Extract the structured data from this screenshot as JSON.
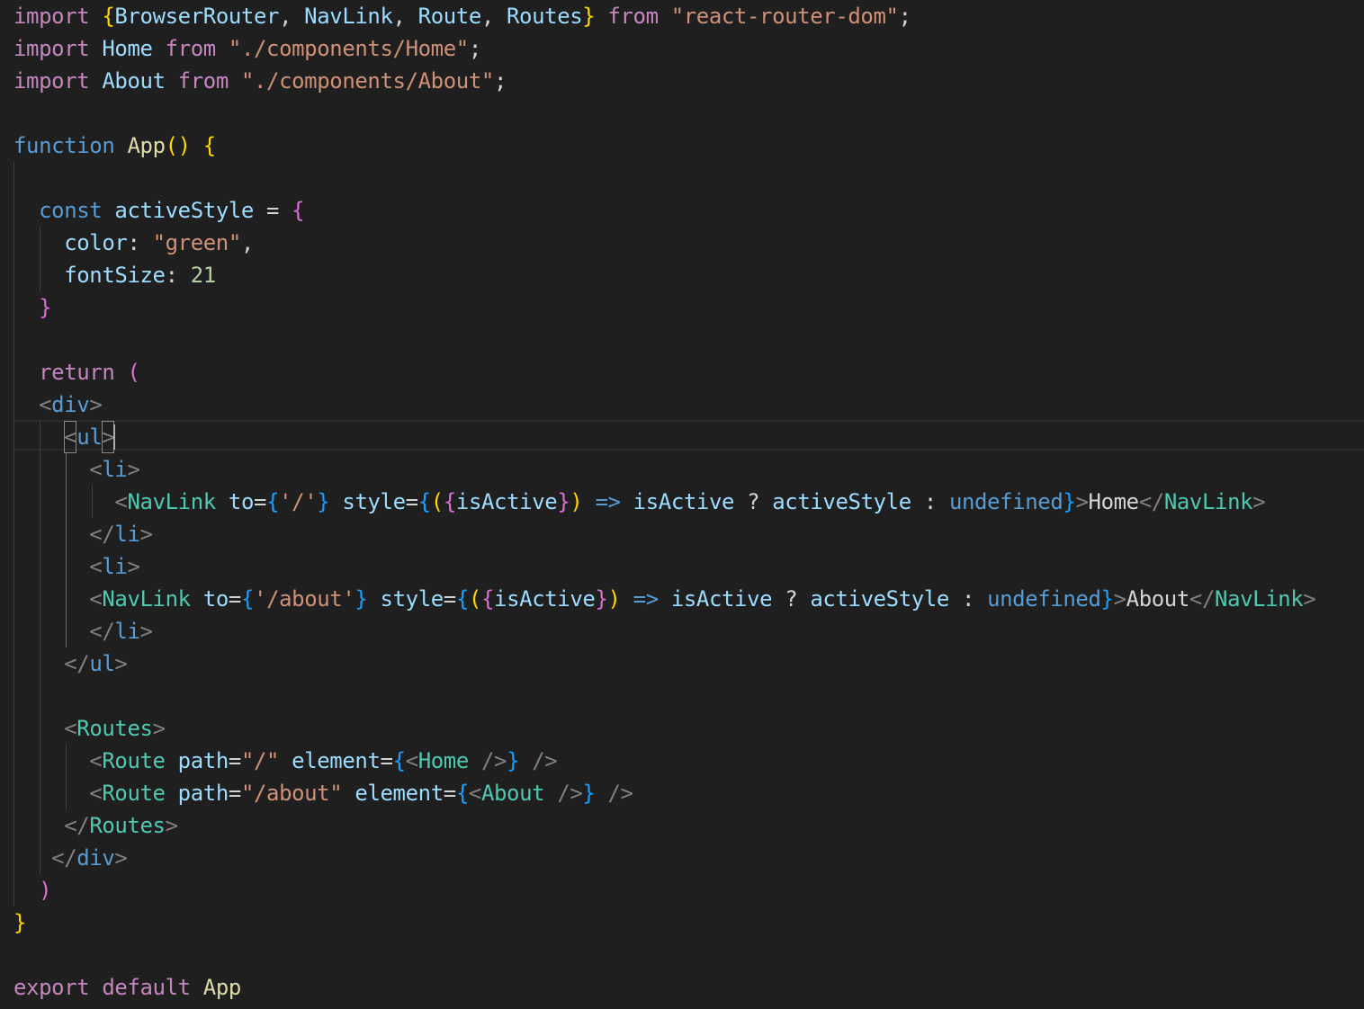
{
  "theme": {
    "background": "#1f1f1f",
    "keyword": "#c586c0",
    "storage": "#569cd6",
    "string": "#ce9178",
    "function": "#dcdcaa",
    "variable": "#9cdcfe",
    "type": "#4ec9b0",
    "number": "#b5cea8",
    "text": "#d4d4d4",
    "tag_bracket": "#808080",
    "bracket_gold": "#ffd700",
    "bracket_purple": "#da70d6",
    "bracket_blue": "#179fff"
  },
  "code": {
    "lines": [
      [
        [
          "import",
          "kw"
        ],
        [
          " ",
          "t"
        ],
        [
          "{",
          "b1"
        ],
        [
          "BrowserRouter",
          "v"
        ],
        [
          ", ",
          "t"
        ],
        [
          "NavLink",
          "v"
        ],
        [
          ", ",
          "t"
        ],
        [
          "Route",
          "v"
        ],
        [
          ", ",
          "t"
        ],
        [
          "Routes",
          "v"
        ],
        [
          "}",
          "b1"
        ],
        [
          " ",
          "t"
        ],
        [
          "from",
          "kw"
        ],
        [
          " ",
          "t"
        ],
        [
          "\"react-router-dom\"",
          "s"
        ],
        [
          ";",
          "t"
        ]
      ],
      [
        [
          "import",
          "kw"
        ],
        [
          " ",
          "t"
        ],
        [
          "Home",
          "v"
        ],
        [
          " ",
          "t"
        ],
        [
          "from",
          "kw"
        ],
        [
          " ",
          "t"
        ],
        [
          "\"./components/Home\"",
          "s"
        ],
        [
          ";",
          "t"
        ]
      ],
      [
        [
          "import",
          "kw"
        ],
        [
          " ",
          "t"
        ],
        [
          "About",
          "v"
        ],
        [
          " ",
          "t"
        ],
        [
          "from",
          "kw"
        ],
        [
          " ",
          "t"
        ],
        [
          "\"./components/About\"",
          "s"
        ],
        [
          ";",
          "t"
        ]
      ],
      [],
      [
        [
          "function",
          "st"
        ],
        [
          " ",
          "t"
        ],
        [
          "App",
          "f"
        ],
        [
          "()",
          "b1"
        ],
        [
          " ",
          "t"
        ],
        [
          "{",
          "b1"
        ]
      ],
      [],
      [
        [
          "  ",
          "t"
        ],
        [
          "const",
          "st"
        ],
        [
          " ",
          "t"
        ],
        [
          "activeStyle",
          "v"
        ],
        [
          " = ",
          "t"
        ],
        [
          "{",
          "b2"
        ]
      ],
      [
        [
          "    ",
          "t"
        ],
        [
          "color",
          "v"
        ],
        [
          ": ",
          "t"
        ],
        [
          "\"green\"",
          "s"
        ],
        [
          ",",
          "t"
        ]
      ],
      [
        [
          "    ",
          "t"
        ],
        [
          "fontSize",
          "v"
        ],
        [
          ": ",
          "t"
        ],
        [
          "21",
          "n"
        ]
      ],
      [
        [
          "  ",
          "t"
        ],
        [
          "}",
          "b2"
        ]
      ],
      [],
      [
        [
          "  ",
          "t"
        ],
        [
          "return",
          "kw"
        ],
        [
          " ",
          "t"
        ],
        [
          "(",
          "b2"
        ]
      ],
      [
        [
          "  ",
          "t"
        ],
        [
          "<",
          "g"
        ],
        [
          "div",
          "st"
        ],
        [
          ">",
          "g"
        ]
      ],
      [
        [
          "    ",
          "t"
        ],
        [
          "<",
          "gbox"
        ],
        [
          "ul",
          "st"
        ],
        [
          ">",
          "gbox"
        ]
      ],
      [
        [
          "      ",
          "t"
        ],
        [
          "<",
          "g"
        ],
        [
          "li",
          "st"
        ],
        [
          ">",
          "g"
        ]
      ],
      [
        [
          "        ",
          "t"
        ],
        [
          "<",
          "g"
        ],
        [
          "NavLink",
          "ty"
        ],
        [
          " ",
          "t"
        ],
        [
          "to",
          "v"
        ],
        [
          "=",
          "t"
        ],
        [
          "{",
          "b3"
        ],
        [
          "'/'",
          "s"
        ],
        [
          "}",
          "b3"
        ],
        [
          " ",
          "t"
        ],
        [
          "style",
          "v"
        ],
        [
          "=",
          "t"
        ],
        [
          "{",
          "b3"
        ],
        [
          "(",
          "b1"
        ],
        [
          "{",
          "b2"
        ],
        [
          "isActive",
          "v"
        ],
        [
          "}",
          "b2"
        ],
        [
          ")",
          "b1"
        ],
        [
          " ",
          "t"
        ],
        [
          "=>",
          "st"
        ],
        [
          " ",
          "t"
        ],
        [
          "isActive",
          "v"
        ],
        [
          " ? ",
          "t"
        ],
        [
          "activeStyle",
          "v"
        ],
        [
          " : ",
          "t"
        ],
        [
          "undefined",
          "st"
        ],
        [
          "}",
          "b3"
        ],
        [
          ">",
          "g"
        ],
        [
          "Home",
          "t"
        ],
        [
          "</",
          "g"
        ],
        [
          "NavLink",
          "ty"
        ],
        [
          ">",
          "g"
        ]
      ],
      [
        [
          "      ",
          "t"
        ],
        [
          "</",
          "g"
        ],
        [
          "li",
          "st"
        ],
        [
          ">",
          "g"
        ]
      ],
      [
        [
          "      ",
          "t"
        ],
        [
          "<",
          "g"
        ],
        [
          "li",
          "st"
        ],
        [
          ">",
          "g"
        ]
      ],
      [
        [
          "      ",
          "t"
        ],
        [
          "<",
          "g"
        ],
        [
          "NavLink",
          "ty"
        ],
        [
          " ",
          "t"
        ],
        [
          "to",
          "v"
        ],
        [
          "=",
          "t"
        ],
        [
          "{",
          "b3"
        ],
        [
          "'/about'",
          "s"
        ],
        [
          "}",
          "b3"
        ],
        [
          " ",
          "t"
        ],
        [
          "style",
          "v"
        ],
        [
          "=",
          "t"
        ],
        [
          "{",
          "b3"
        ],
        [
          "(",
          "b1"
        ],
        [
          "{",
          "b2"
        ],
        [
          "isActive",
          "v"
        ],
        [
          "}",
          "b2"
        ],
        [
          ")",
          "b1"
        ],
        [
          " ",
          "t"
        ],
        [
          "=>",
          "st"
        ],
        [
          " ",
          "t"
        ],
        [
          "isActive",
          "v"
        ],
        [
          " ? ",
          "t"
        ],
        [
          "activeStyle",
          "v"
        ],
        [
          " : ",
          "t"
        ],
        [
          "undefined",
          "st"
        ],
        [
          "}",
          "b3"
        ],
        [
          ">",
          "g"
        ],
        [
          "About",
          "t"
        ],
        [
          "</",
          "g"
        ],
        [
          "NavLink",
          "ty"
        ],
        [
          ">",
          "g"
        ]
      ],
      [
        [
          "      ",
          "t"
        ],
        [
          "</",
          "g"
        ],
        [
          "li",
          "st"
        ],
        [
          ">",
          "g"
        ]
      ],
      [
        [
          "    ",
          "t"
        ],
        [
          "</",
          "g"
        ],
        [
          "ul",
          "st"
        ],
        [
          ">",
          "g"
        ]
      ],
      [],
      [
        [
          "    ",
          "t"
        ],
        [
          "<",
          "g"
        ],
        [
          "Routes",
          "ty"
        ],
        [
          ">",
          "g"
        ]
      ],
      [
        [
          "      ",
          "t"
        ],
        [
          "<",
          "g"
        ],
        [
          "Route",
          "ty"
        ],
        [
          " ",
          "t"
        ],
        [
          "path",
          "v"
        ],
        [
          "=",
          "t"
        ],
        [
          "\"/\"",
          "s"
        ],
        [
          " ",
          "t"
        ],
        [
          "element",
          "v"
        ],
        [
          "=",
          "t"
        ],
        [
          "{",
          "b3"
        ],
        [
          "<",
          "g"
        ],
        [
          "Home",
          "ty"
        ],
        [
          " ",
          "t"
        ],
        [
          "/>",
          "g"
        ],
        [
          "}",
          "b3"
        ],
        [
          " ",
          "t"
        ],
        [
          "/>",
          "g"
        ]
      ],
      [
        [
          "      ",
          "t"
        ],
        [
          "<",
          "g"
        ],
        [
          "Route",
          "ty"
        ],
        [
          " ",
          "t"
        ],
        [
          "path",
          "v"
        ],
        [
          "=",
          "t"
        ],
        [
          "\"/about\"",
          "s"
        ],
        [
          " ",
          "t"
        ],
        [
          "element",
          "v"
        ],
        [
          "=",
          "t"
        ],
        [
          "{",
          "b3"
        ],
        [
          "<",
          "g"
        ],
        [
          "About",
          "ty"
        ],
        [
          " ",
          "t"
        ],
        [
          "/>",
          "g"
        ],
        [
          "}",
          "b3"
        ],
        [
          " ",
          "t"
        ],
        [
          "/>",
          "g"
        ]
      ],
      [
        [
          "    ",
          "t"
        ],
        [
          "</",
          "g"
        ],
        [
          "Routes",
          "ty"
        ],
        [
          ">",
          "g"
        ]
      ],
      [
        [
          "   ",
          "t"
        ],
        [
          "</",
          "g"
        ],
        [
          "div",
          "st"
        ],
        [
          ">",
          "g"
        ]
      ],
      [
        [
          "  ",
          "t"
        ],
        [
          ")",
          "b2"
        ]
      ],
      [
        [
          "}",
          "b1"
        ]
      ],
      [],
      [
        [
          "export",
          "kw"
        ],
        [
          " ",
          "t"
        ],
        [
          "default",
          "kw"
        ],
        [
          " ",
          "t"
        ],
        [
          "App",
          "f"
        ]
      ]
    ]
  }
}
